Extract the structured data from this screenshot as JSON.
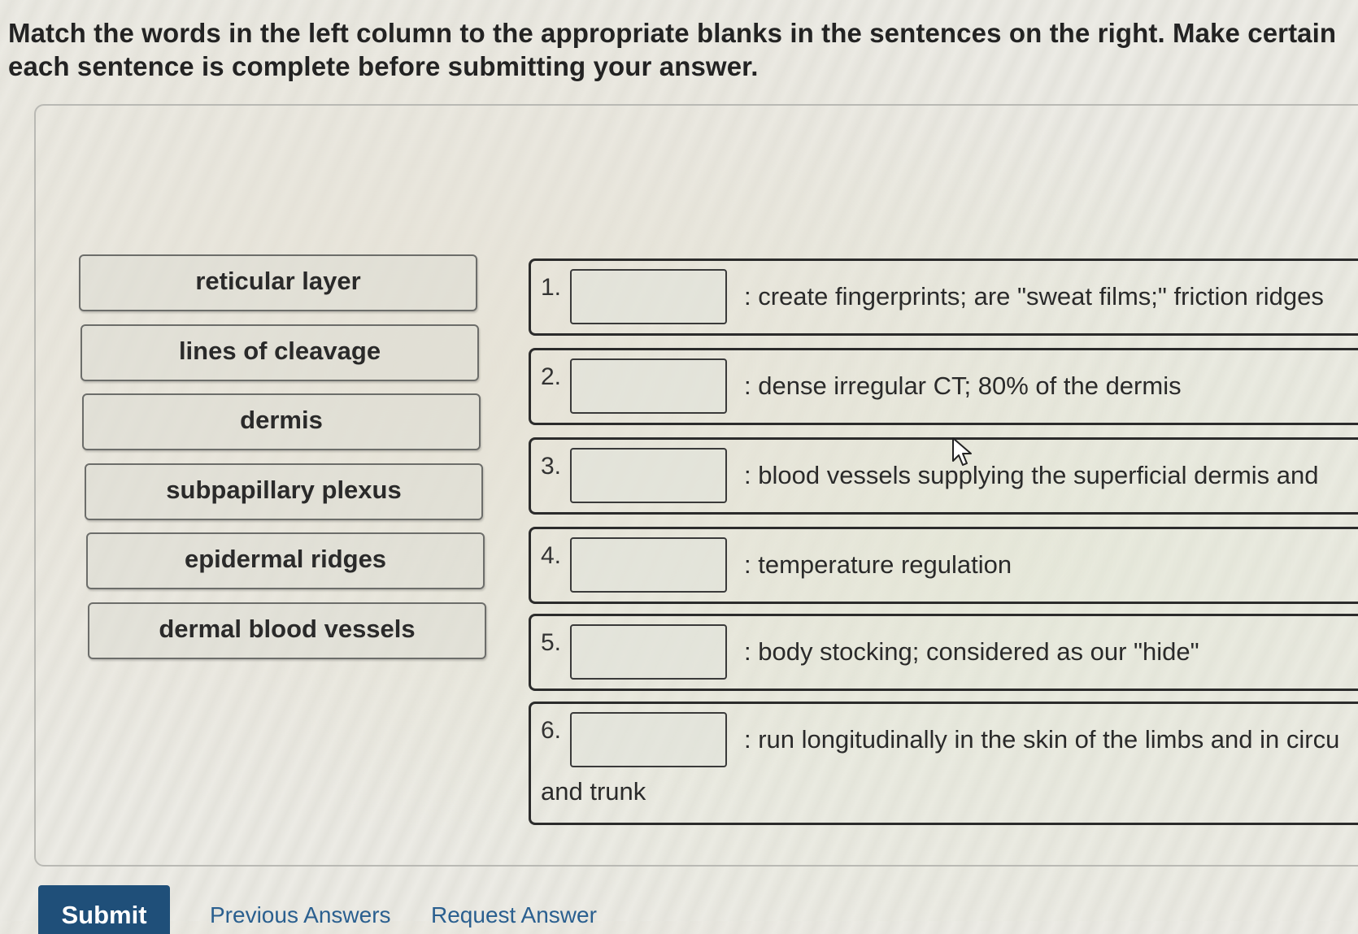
{
  "instructions": "Match the words in the left column to the appropriate blanks in the sentences on the right. Make certain each sentence is complete before submitting your answer.",
  "word_bank": [
    "reticular layer",
    "lines of cleavage",
    "dermis",
    "subpapillary plexus",
    "epidermal ridges",
    "dermal blood vessels"
  ],
  "sentences": [
    {
      "number": "1.",
      "text": ": create fingerprints; are \"sweat films;\" friction ridges",
      "continuation": ""
    },
    {
      "number": "2.",
      "text": ": dense irregular CT; 80% of the dermis",
      "continuation": ""
    },
    {
      "number": "3.",
      "text": ": blood vessels supplying the superficial dermis and",
      "continuation": ""
    },
    {
      "number": "4.",
      "text": ": temperature regulation",
      "continuation": ""
    },
    {
      "number": "5.",
      "text": ": body stocking; considered as our \"hide\"",
      "continuation": ""
    },
    {
      "number": "6.",
      "text": ": run longitudinally in the skin of the limbs and in circu",
      "continuation": "and trunk"
    }
  ],
  "actions": {
    "submit": "Submit",
    "previous_answers": "Previous Answers",
    "request_answer": "Request Answer"
  },
  "colors": {
    "submit_bg": "#1f4f79",
    "link": "#2a5f8f"
  }
}
